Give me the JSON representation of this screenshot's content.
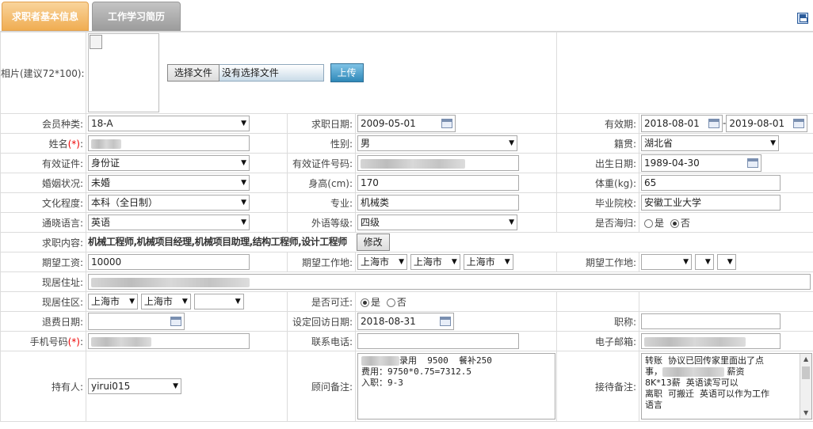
{
  "tabs": {
    "basic": "求职者基本信息",
    "history": "工作学习简历"
  },
  "photo": {
    "label": "相片(建议72*100):",
    "choose_button": "选择文件",
    "no_file": "没有选择文件",
    "upload_button": "上传"
  },
  "member_type": {
    "label": "会员种类:",
    "value": "18-A"
  },
  "job_date": {
    "label": "求职日期:",
    "value": "2009-05-01"
  },
  "validity": {
    "label": "有效期:",
    "start": "2018-08-01",
    "separator": "-",
    "end": "2019-08-01"
  },
  "name": {
    "label": "姓名",
    "req": "(*)",
    "colon": ":"
  },
  "gender": {
    "label": "性别:",
    "value": "男"
  },
  "native_place": {
    "label": "籍贯:",
    "value": "湖北省"
  },
  "id_type": {
    "label": "有效证件:",
    "value": "身份证"
  },
  "id_number": {
    "label": "有效证件号码:"
  },
  "birth_date": {
    "label": "出生日期:",
    "value": "1989-04-30"
  },
  "marital": {
    "label": "婚姻状况:",
    "value": "未婚"
  },
  "height": {
    "label": "身高(cm):",
    "value": "170"
  },
  "weight": {
    "label": "体重(kg):",
    "value": "65"
  },
  "education": {
    "label": "文化程度:",
    "value": "本科（全日制）"
  },
  "major": {
    "label": "专业:",
    "value": "机械类"
  },
  "school": {
    "label": "毕业院校:",
    "value": "安徽工业大学"
  },
  "language": {
    "label": "通晓语言:",
    "value": "英语"
  },
  "language_level": {
    "label": "外语等级:",
    "value": "四级"
  },
  "overseas": {
    "label": "是否海归:",
    "yes": "是",
    "no": "否",
    "selected": "no"
  },
  "job_content": {
    "label": "求职内容:",
    "value": "机械工程师,机械项目经理,机械项目助理,结构工程师,设计工程师",
    "edit_button": "修改"
  },
  "salary": {
    "label": "期望工资:",
    "value": "10000"
  },
  "work_place": {
    "label": "期望工作地:",
    "province": "上海市",
    "city": "上海市",
    "district": "上海市"
  },
  "work_place2": {
    "label": "期望工作地:"
  },
  "address": {
    "label": "现居住址:"
  },
  "district": {
    "label": "现居住区:",
    "province": "上海市",
    "city": "上海市"
  },
  "relocate": {
    "label": "是否可迁:",
    "yes": "是",
    "no": "否",
    "selected": "yes"
  },
  "refund_date": {
    "label": "退费日期:"
  },
  "revisit_date": {
    "label": "设定回访日期:",
    "value": "2018-08-31"
  },
  "title": {
    "label": "职称:"
  },
  "mobile": {
    "label": "手机号码",
    "req": "(*)",
    "colon": ":"
  },
  "phone": {
    "label": "联系电话:"
  },
  "email": {
    "label": "电子邮箱:"
  },
  "holder": {
    "label": "持有人:",
    "value": "yirui015"
  },
  "consultant_note": {
    "label": "顾问备注:",
    "line1": "录用  9500  餐补250",
    "line2": "费用：9750*0.75=7312.5",
    "line3": "入职：9-3"
  },
  "reception_note": {
    "label": "接待备注:",
    "line1": "转账  协议已回传家里面出了点",
    "line2a": "事，",
    "line2b": "薪资",
    "line3": "8K*13薪  英语读写可以",
    "line4": "离职  可搬迁  英语可以作为工作",
    "line5": "语言"
  }
}
